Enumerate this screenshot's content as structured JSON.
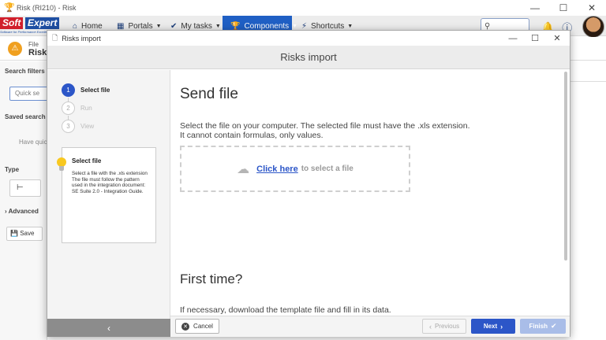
{
  "window": {
    "title": "Risk (RI210) - Risk",
    "minimize": "—",
    "maximize": "☐",
    "close": "✕"
  },
  "logo": {
    "soft": "Soft",
    "expert": "Expert",
    "tagline": "Software for Performance Excellence"
  },
  "navbar": {
    "items": [
      {
        "label": "Home",
        "icon": "home-icon",
        "glyph": "⌂"
      },
      {
        "label": "Portals",
        "icon": "grid-icon",
        "glyph": "▦"
      },
      {
        "label": "My tasks",
        "icon": "check-icon",
        "glyph": "✔"
      },
      {
        "label": "Components",
        "icon": "trophy-icon",
        "glyph": "🏆"
      },
      {
        "label": "Shortcuts",
        "icon": "bolt-icon",
        "glyph": "⚡"
      }
    ],
    "active_index": 3
  },
  "background": {
    "file_label": "File",
    "risk_label": "Risk",
    "search_filters": "Search filters",
    "quick_search": "Quick se",
    "saved_search": "Saved search",
    "have_quick": "Have quick",
    "type": "Type",
    "advanced": "Advanced",
    "save": "Save"
  },
  "modal": {
    "title": "Risks import",
    "header": "Risks import",
    "steps": [
      {
        "num": "1",
        "label": "Select file",
        "active": true
      },
      {
        "num": "2",
        "label": "Run",
        "active": false
      },
      {
        "num": "3",
        "label": "View",
        "active": false
      }
    ],
    "tip": {
      "title": "Select file",
      "body": "Select a file with the .xls extension\nThe file must follow the pattern used in the integration document: SE Suite 2.0 - Integration Guide."
    },
    "content": {
      "heading": "Send file",
      "text1": "Select the file on your computer. The selected file must have the .xls extension.",
      "text2": "It cannot contain formulas, only values.",
      "dropzone_link": "Click here",
      "dropzone_rest": "to select a file",
      "heading2": "First time?",
      "text3": "If necessary, download the template file and fill in its data."
    },
    "footer": {
      "back_arrow": "‹",
      "cancel": "Cancel",
      "previous": "Previous",
      "next": "Next",
      "finish": "Finish"
    }
  }
}
